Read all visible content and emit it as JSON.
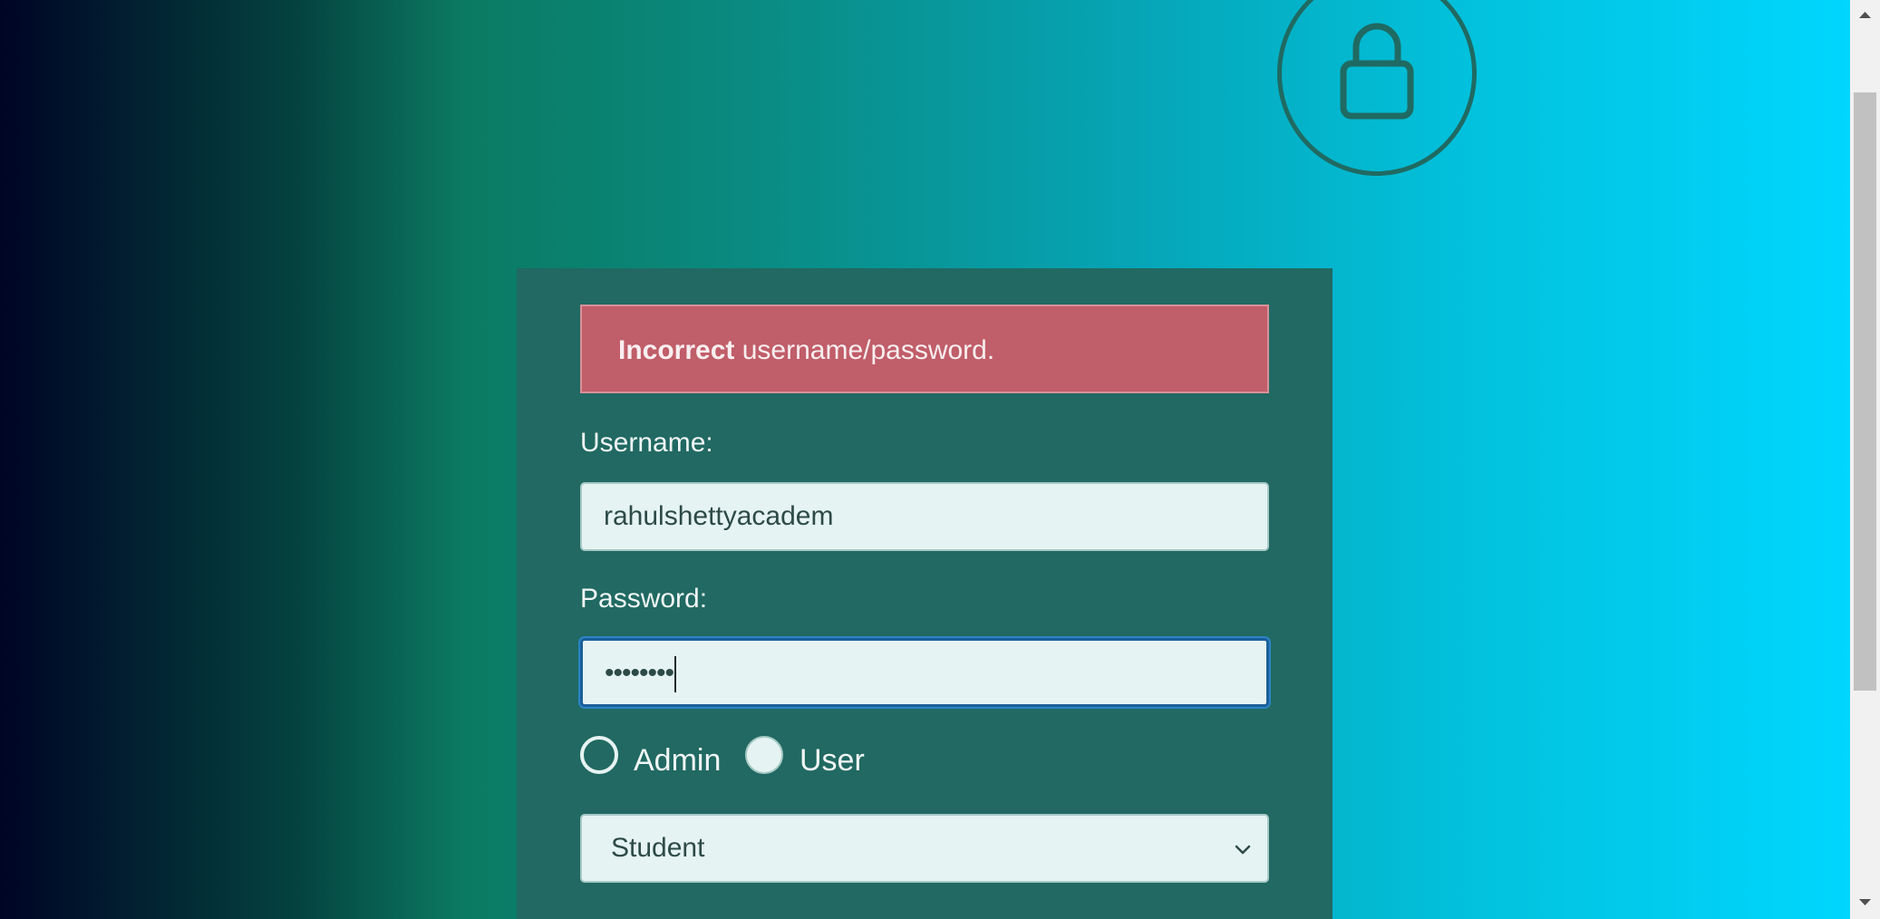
{
  "alert": {
    "strong": "Incorrect",
    "message": " username/password."
  },
  "form": {
    "username_label": "Username:",
    "username_value": "rahulshettyacadem",
    "password_label": "Password:",
    "password_masked": "••••••••",
    "radio_admin_label": "Admin",
    "radio_user_label": "User",
    "role_selected": "Student"
  },
  "icons": {
    "lock": "lock-icon",
    "chevron": "chevron-down-icon"
  },
  "colors": {
    "card_bg": "#216962",
    "alert_bg": "#c05e69",
    "input_bg": "#e5f4f3",
    "focus_border": "#1b5f9a"
  }
}
